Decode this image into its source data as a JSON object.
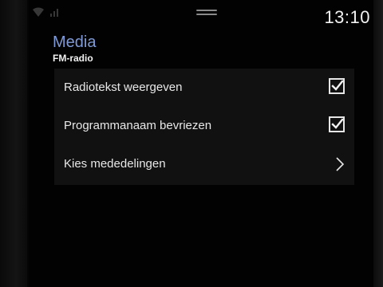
{
  "status": {
    "time": "13:10"
  },
  "header": {
    "title": "Media",
    "subtitle": "FM-radio"
  },
  "settings": {
    "items": [
      {
        "label": "Radiotekst weergeven",
        "control": "checkbox",
        "checked": true
      },
      {
        "label": "Programmanaam bevriezen",
        "control": "checkbox",
        "checked": true
      },
      {
        "label": "Kies mededelingen",
        "control": "chevron-right-icon"
      }
    ]
  },
  "colors": {
    "background": "#020202",
    "title": "#7f9ad6",
    "text": "#e8e8e8",
    "list_background": "#111111"
  }
}
